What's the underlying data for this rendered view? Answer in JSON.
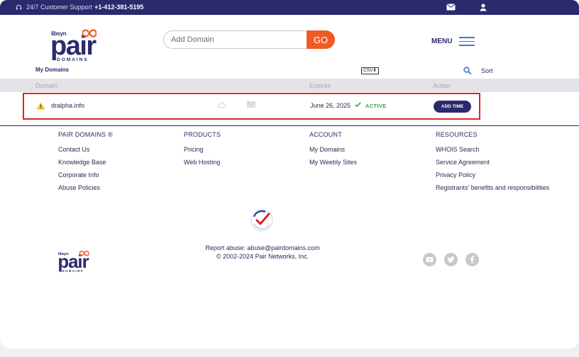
{
  "topbar": {
    "support_label": "24/7 Customer Support",
    "support_phone": "+1-412-381-5195"
  },
  "logo": {
    "libsyn": "libsyn",
    "pair": "pair",
    "domains": "DOMAINS"
  },
  "search": {
    "placeholder": "Add Domain",
    "go_label": "GO"
  },
  "menu": {
    "label": "MENU"
  },
  "domains": {
    "title": "My Domains",
    "csv_label": "CSV",
    "sort_label": "Sort",
    "columns": [
      "Domain",
      "Expires",
      "Action"
    ],
    "rows": [
      {
        "domain": "dralpha.info",
        "expires": "June 26, 2025",
        "status": "ACTIVE",
        "action": "ADD TIME"
      }
    ]
  },
  "footer": {
    "columns": [
      {
        "head": "PAIR DOMAINS ®",
        "links": [
          "Contact Us",
          "Knowledge Base",
          "Corporate Info",
          "Abuse Policies"
        ]
      },
      {
        "head": "PRODUCTS",
        "links": [
          "Pricing",
          "Web Hosting"
        ]
      },
      {
        "head": "ACCOUNT",
        "links": [
          "My Domains",
          "My Weebly Sites"
        ]
      },
      {
        "head": "RESOURCES",
        "links": [
          "WHOIS Search",
          "Service Agreement",
          "Privacy Policy",
          "Registrants' benefits and responsibilities"
        ]
      }
    ],
    "abuse_text": "Report abuse: abuse@pairdomains.com",
    "copyright": "© 2002-2024 Pair Networks, Inc.",
    "social": [
      "youtube-icon",
      "twitter-icon",
      "facebook-icon"
    ]
  },
  "colors": {
    "brand_navy": "#2b2a6e",
    "accent_orange": "#f05a24",
    "active_green": "#3aa047",
    "highlight_red": "#e0252f"
  }
}
